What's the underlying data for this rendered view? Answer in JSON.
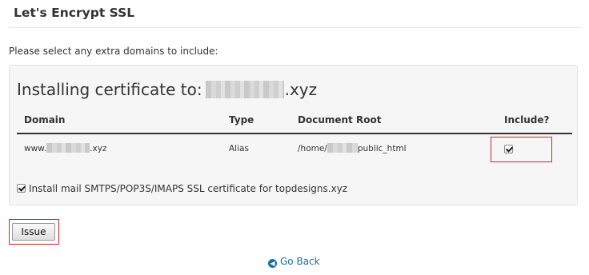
{
  "header": {
    "title": "Let's Encrypt SSL"
  },
  "instructions": "Please select any extra domains to include:",
  "panel": {
    "heading_prefix": "Installing certificate to:",
    "heading_suffix": ".xyz",
    "columns": {
      "domain": "Domain",
      "type": "Type",
      "document_root": "Document Root",
      "include": "Include?"
    },
    "rows": [
      {
        "domain_prefix": "www.",
        "domain_suffix": ".xyz",
        "type": "Alias",
        "docroot_prefix": "/home/",
        "docroot_suffix": "public_html",
        "include_checked": true
      }
    ],
    "mail_option": {
      "label": "Install mail SMTPS/POP3S/IMAPS SSL certificate for topdesigns.xyz",
      "checked": true
    }
  },
  "actions": {
    "issue_label": "Issue",
    "go_back_label": "Go Back",
    "go_back_icon": "circle-arrow-left-icon"
  },
  "colors": {
    "highlight": "#d9232d",
    "link": "#1a6fa3",
    "panel_bg": "#f6f6f6"
  }
}
